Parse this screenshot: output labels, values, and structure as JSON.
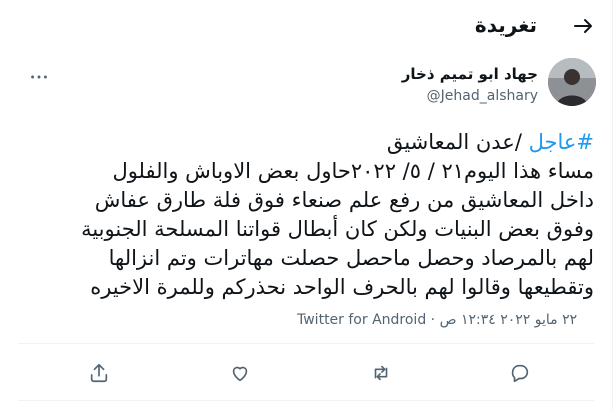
{
  "header": {
    "title": "تغريدة",
    "back_icon": "arrow-right-icon"
  },
  "author": {
    "name": "جهاد ابو تميم ذخار",
    "handle": "@Jehad_alshary",
    "avatar": "avatar-photo"
  },
  "tweet": {
    "hashtag": "#عاجل",
    "line1_rest": " /عدن المعاشيق",
    "line2": "مساء هذا اليوم٢١ / ٥/ ٢٠٢٢حاول بعض الاوباش والفلول",
    "line3": "داخل المعاشيق من رفع علم صنعاء فوق فلة طارق عفاش",
    "line4": "وفوق بعض البنيات ولكن كان أبطال قواتنا المسلحة الجنوبية",
    "line5": "لهم بالمرصاد وحصل ماحصل حصلت مهاترات وتم انزالها",
    "line6": "وتقطيعها وقالوا لهم بالحرف الواحد نحذركم وللمرة الاخيره"
  },
  "meta": {
    "time": "١٢:٣٤ ص",
    "separator": " · ",
    "date": "٢٢ مايو ٢٠٢٢",
    "source": "Twitter for Android"
  },
  "actions": {
    "reply_icon": "reply-icon",
    "retweet_icon": "retweet-icon",
    "like_icon": "heart-icon",
    "share_icon": "share-icon"
  },
  "colors": {
    "accent": "#1d9bf0",
    "text": "#0f1419",
    "secondary": "#536471"
  }
}
